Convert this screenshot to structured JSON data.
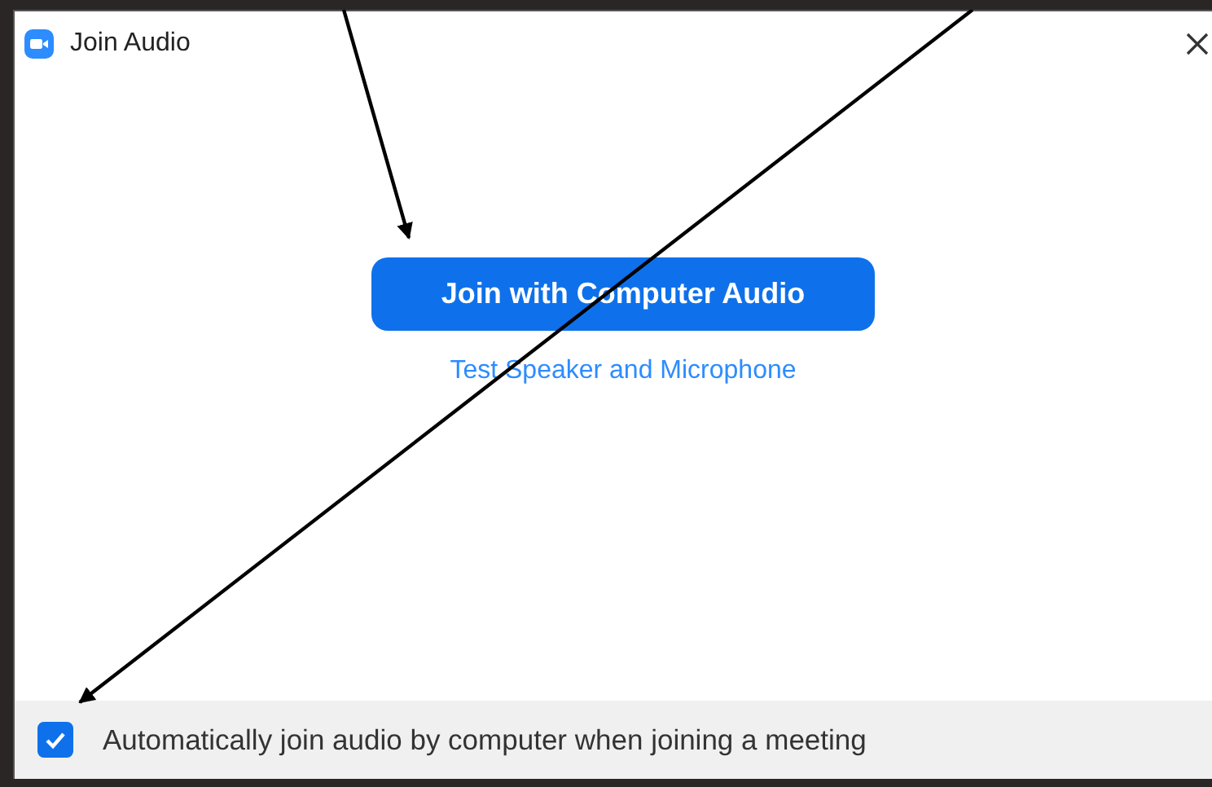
{
  "window": {
    "title": "Join Audio"
  },
  "primary_button": {
    "label": "Join with Computer Audio"
  },
  "link": {
    "label": "Test Speaker and Microphone"
  },
  "footer": {
    "checkbox": {
      "label": "Automatically join audio by computer when joining a meeting",
      "checked": true
    }
  }
}
